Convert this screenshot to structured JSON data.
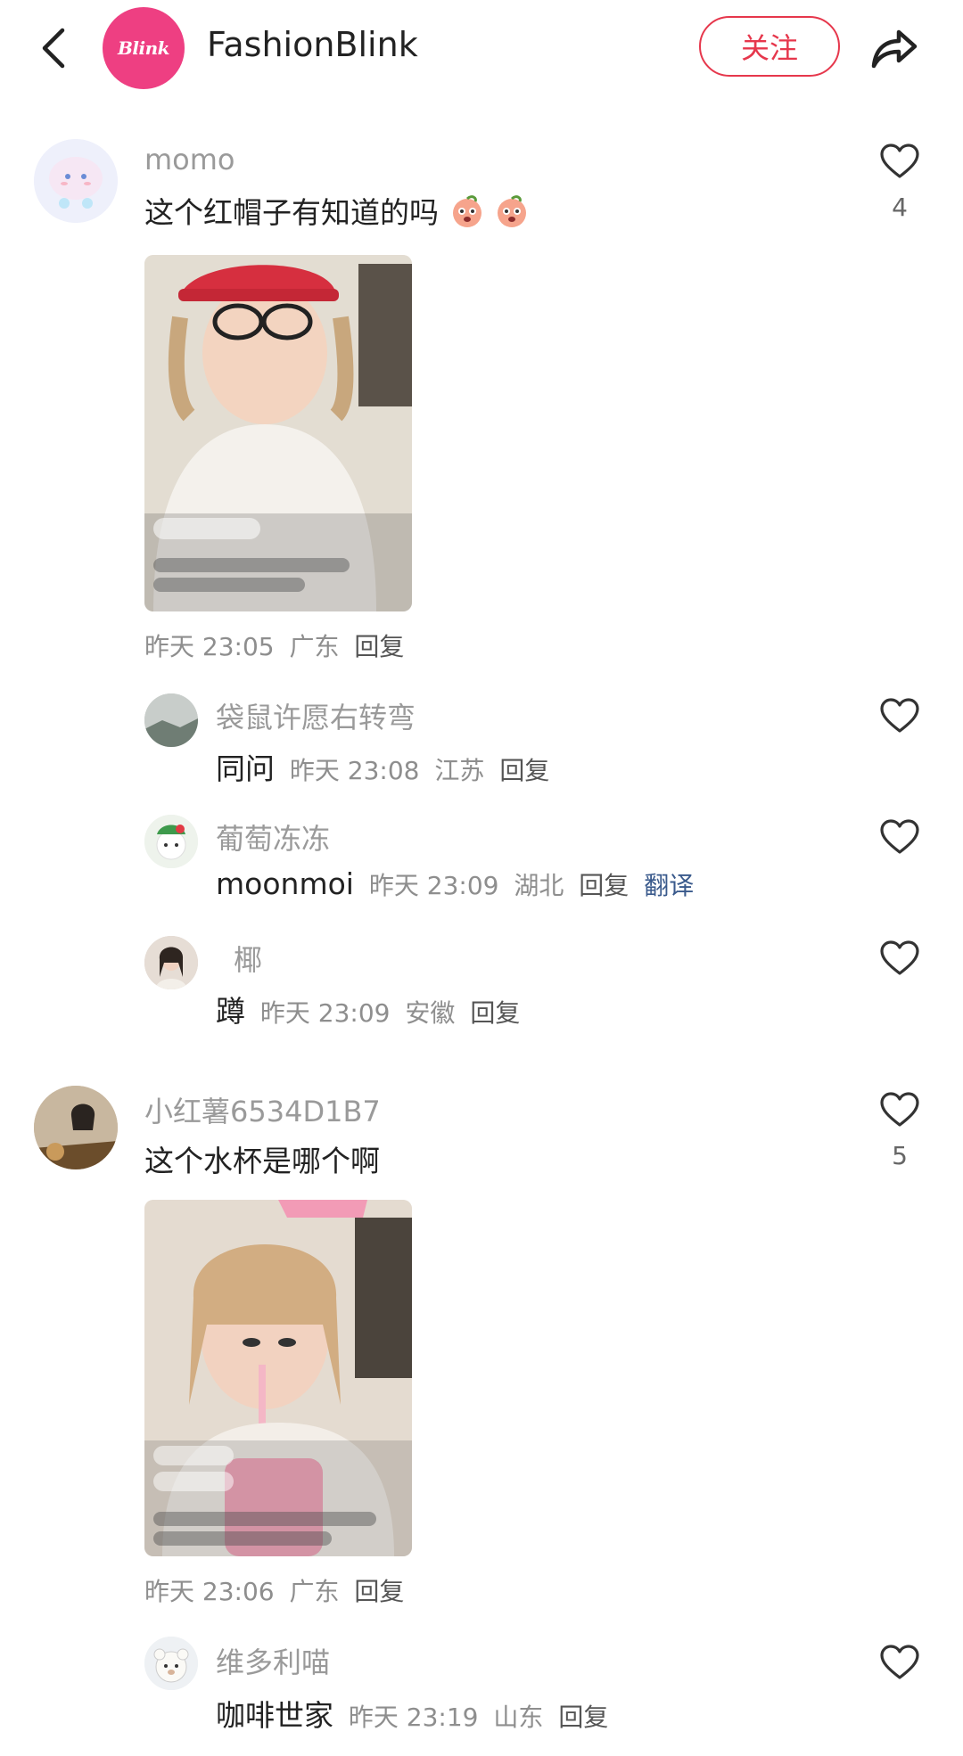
{
  "header": {
    "account_name": "FashionBlink",
    "logo_text": "Blink",
    "follow_label": "关注",
    "brand_color": "#ee3f82",
    "icons": {
      "back": "chevron-left-icon",
      "share": "share-arrow-icon"
    }
  },
  "comments": [
    {
      "username": "momo",
      "text": "这个红帽子有知道的吗",
      "emoji": "peach-face-emoji",
      "likes": "4",
      "time": "昨天 23:05",
      "location": "广东",
      "reply_label": "回复",
      "image": "comment-photo-red-cap"
    },
    {
      "username": "袋鼠许愿右转弯",
      "text": "同问",
      "time": "昨天 23:08",
      "location": "江苏",
      "reply_label": "回复"
    },
    {
      "username": "葡萄冻冻",
      "text": "moonmoi",
      "time": "昨天 23:09",
      "location": "湖北",
      "reply_label": "回复",
      "translate_label": "翻译"
    },
    {
      "username": "椰",
      "text": "蹲",
      "time": "昨天 23:09",
      "location": "安徽",
      "reply_label": "回复"
    },
    {
      "username": "小红薯6534D1B7",
      "text": "这个水杯是哪个啊",
      "likes": "5",
      "time": "昨天 23:06",
      "location": "广东",
      "reply_label": "回复",
      "image": "comment-photo-water-cup"
    },
    {
      "username": "维多利喵",
      "text": "咖啡世家",
      "time": "昨天 23:19",
      "location": "山东",
      "reply_label": "回复"
    }
  ],
  "colors": {
    "follow_accent": "#e6374c",
    "meta_text": "#8e8e8e",
    "username_text": "#9a9a9a",
    "translate_link": "#3a5a8c"
  }
}
